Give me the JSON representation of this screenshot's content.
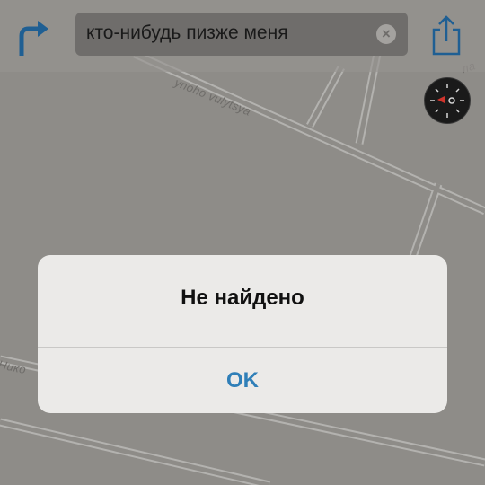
{
  "search": {
    "query": "кто-нибудь пизже меня"
  },
  "map": {
    "street_labels": {
      "top": "ynoho vulytsya",
      "left": "Нико",
      "corner": "ла"
    }
  },
  "alert": {
    "title": "Не найдено",
    "button_label": "OK"
  },
  "colors": {
    "accent": "#2f7fb8",
    "map_background": "#8e8c88",
    "road": "#b1b0ad"
  }
}
